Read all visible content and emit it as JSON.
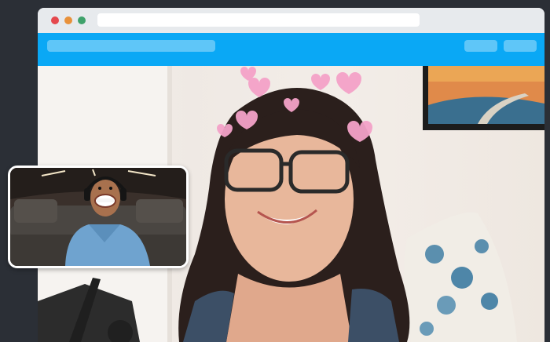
{
  "window": {
    "controls": [
      {
        "name": "close",
        "color": "#e5484d"
      },
      {
        "name": "minimize",
        "color": "#e8913a"
      },
      {
        "name": "maximize",
        "color": "#3fa26b"
      }
    ]
  },
  "appbar": {
    "color": "#0aa8f5"
  },
  "call": {
    "main_video": {
      "filter": "hearts",
      "icons": [
        "heart-icon"
      ]
    },
    "self_view": {
      "filter": "face-mask"
    }
  }
}
